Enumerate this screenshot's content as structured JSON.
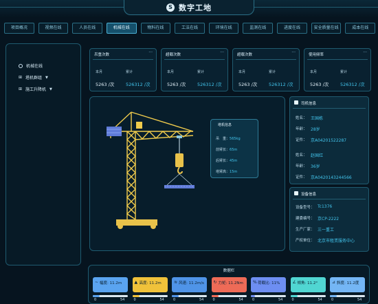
{
  "header": {
    "title": "数字工地",
    "logo_text": "S"
  },
  "nav": {
    "tabs": [
      "项目概况",
      "视频在线",
      "人员在线",
      "机械在线",
      "物料在线",
      "工法在线",
      "环境在线",
      "监测在线",
      "进度在线",
      "安全质量在线",
      "成本在线"
    ],
    "active_index": 3
  },
  "sidebar": {
    "items": [
      {
        "label": "机械在线"
      },
      {
        "label": "塔机群组"
      },
      {
        "label": "施工升降机"
      }
    ]
  },
  "stats": [
    {
      "title": "吊重次数",
      "month_label": "本月",
      "total_label": "累计",
      "month_value": "5263 /次",
      "total_value": "526312 /次"
    },
    {
      "title": "超载次数",
      "month_label": "本月",
      "total_label": "累计",
      "month_value": "5263 /次",
      "total_value": "526312 /次"
    },
    {
      "title": "超载次数",
      "month_label": "本月",
      "total_label": "累计",
      "month_value": "5263 /次",
      "total_value": "526312 /次"
    },
    {
      "title": "使用频率",
      "month_label": "本月",
      "total_label": "累计",
      "month_value": "5263 /次",
      "total_value": "526312 /次"
    }
  ],
  "crane_info": {
    "title": "塔机信息",
    "rows": [
      {
        "label": "吊　重：",
        "value": "565kg"
      },
      {
        "label": "前臂长：",
        "value": "65m"
      },
      {
        "label": "后臂长：",
        "value": "45m"
      },
      {
        "label": "塔臂高：",
        "value": "15m"
      }
    ]
  },
  "driver": {
    "title": "司机信息",
    "people": [
      {
        "name_label": "姓名：",
        "name": "王国栋",
        "age_label": "年龄：",
        "age": "28岁",
        "id_label": "证件：",
        "id": "京A04201522287"
      },
      {
        "name_label": "姓名：",
        "name": "赵国红",
        "age_label": "年龄：",
        "age": "36岁",
        "id_label": "证件：",
        "id": "京A0420143244566"
      }
    ]
  },
  "device": {
    "title": "设备信息",
    "rows": [
      {
        "label": "设备型号：",
        "value": "Tc1376"
      },
      {
        "label": "建委编号：",
        "value": "京CP-2222"
      },
      {
        "label": "生产厂家：",
        "value": "三一重工"
      },
      {
        "label": "产权单位：",
        "value": "北京市租赁服务中心"
      }
    ]
  },
  "sensors": {
    "title": "数据栏",
    "items": [
      {
        "label": "幅度: 11.2m",
        "icon": "~",
        "color": "#5aa4f0",
        "min": "0",
        "max": "54",
        "fill": 0.2
      },
      {
        "label": "高度: 11.2m",
        "icon": "▲",
        "color": "#f0c23a",
        "min": "0",
        "max": "54",
        "fill": 0.2
      },
      {
        "label": "风速: 11.2m/s",
        "icon": "≋",
        "color": "#4f94e8",
        "min": "0",
        "max": "54",
        "fill": 0.2
      },
      {
        "label": "力矩: 11.2Nm",
        "icon": "↻",
        "color": "#ee6b57",
        "min": "0",
        "max": "54",
        "fill": 0.2
      },
      {
        "label": "荷载比: 11%",
        "icon": "%",
        "color": "#6d8ef2",
        "min": "0",
        "max": "54",
        "fill": 0.11
      },
      {
        "label": "倾角: 11.2°",
        "icon": "∠",
        "color": "#50d6d2",
        "min": "0",
        "max": "54",
        "fill": 0.2
      },
      {
        "label": "斜度: 11.2度",
        "icon": "⊿",
        "color": "#74b6f5",
        "min": "0",
        "max": "54",
        "fill": 0.2
      }
    ]
  }
}
